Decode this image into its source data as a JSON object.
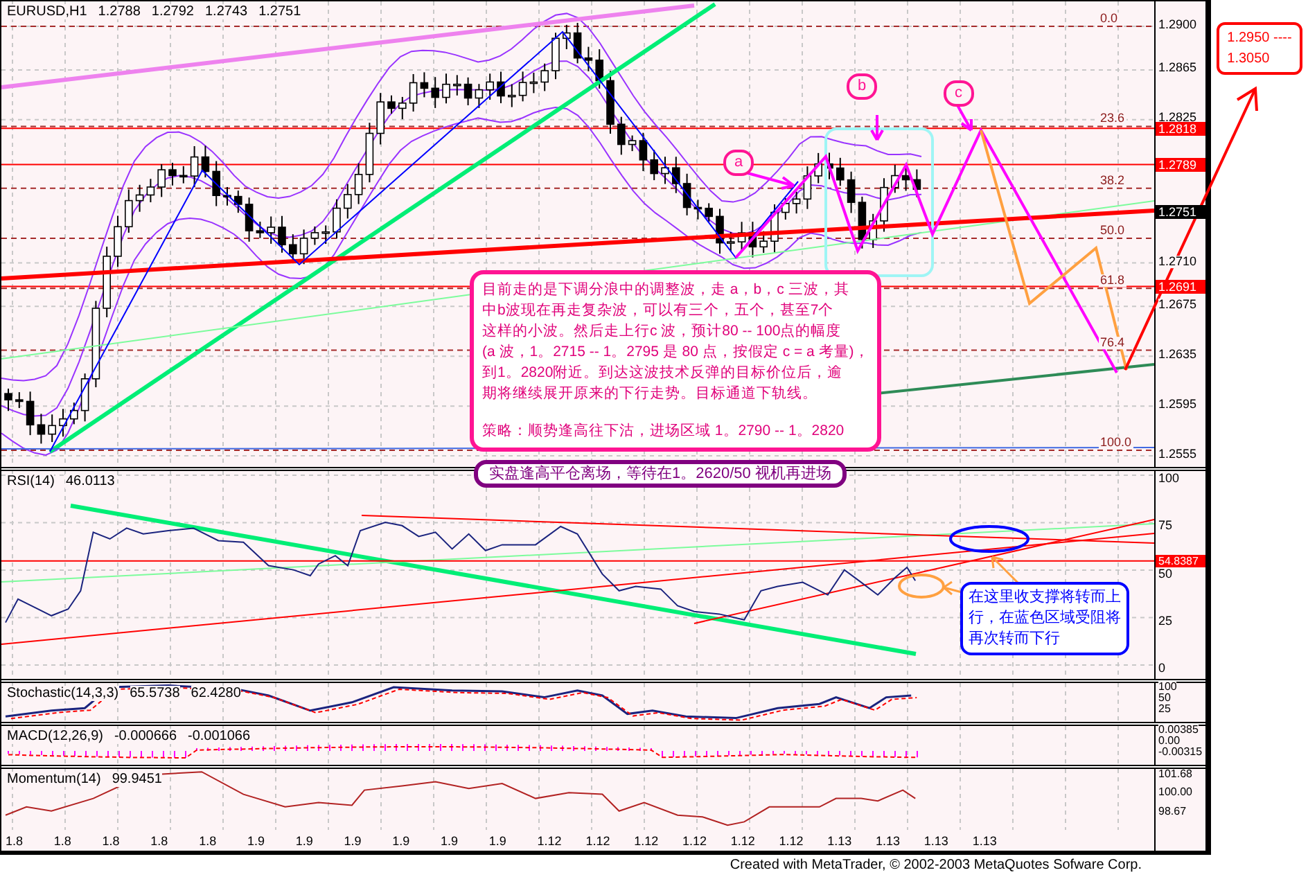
{
  "header": {
    "symbol": "EURUSD,H1",
    "quotes": [
      "1.2788",
      "1.2792",
      "1.2743",
      "1.2751"
    ]
  },
  "main_panel": {
    "price_axis": [
      "1.2900",
      "1.2865",
      "1.2825",
      "1.2710",
      "1.2675",
      "1.2635",
      "1.2595",
      "1.2555"
    ],
    "price_tags": [
      {
        "text": "1.2818",
        "color": "#ff0000"
      },
      {
        "text": "1.2789",
        "color": "#ff0000"
      },
      {
        "text": "1.2751",
        "color": "#000000"
      },
      {
        "text": "1.2691",
        "color": "#ff0000"
      }
    ],
    "fib_levels": [
      "0.0",
      "23.6",
      "38.2",
      "50.0",
      "61.8",
      "76.4",
      "100.0"
    ],
    "wave_labels": [
      "a",
      "b",
      "c"
    ],
    "note": {
      "lines": [
        "目前走的是下调分浪中的调整波，走 a，b，c 三波，其",
        "中b波现在再走复杂波，可以有三个，五个，甚至7个",
        "这样的小波。然后走上行c 波，预计80 -- 100点的幅度",
        "(a 波，1。2715 -- 1。2795 是 80 点，按假定 c = a 考量)，",
        "到1。2820附近。到达这波技术反弹的目标价位后，逾",
        "期将继续展开原来的下行走势。目标通道下轨线。"
      ],
      "strategy": "策略：顺势逢高往下沽，进场区域 1。2790 -- 1。2820"
    }
  },
  "exit_note": "实盘逢高平仓离场，等待在1。2620/50 视机再进场",
  "target_box": {
    "lines": [
      "1.2950 ----",
      "1.3050"
    ]
  },
  "rsi_panel": {
    "label": "RSI(14)",
    "value": "46.0113",
    "axis": [
      "100",
      "75",
      "50",
      "25",
      "0"
    ],
    "tag": "54.8387",
    "note": [
      "在这里收支撑将转而上",
      "行，在蓝色区域受阻将",
      "再次转而下行"
    ]
  },
  "stochastic_panel": {
    "label": "Stochastic(14,3,3)",
    "values": [
      "65.5738",
      "62.4280"
    ],
    "axis": [
      "100",
      "50",
      "25"
    ]
  },
  "macd_panel": {
    "label": "MACD(12,26,9)",
    "values": [
      "-0.000666",
      "-0.001066"
    ],
    "axis": [
      "0.00385",
      "0.00",
      "-0.00315"
    ]
  },
  "momentum_panel": {
    "label": "Momentum(14)",
    "value": "99.9451",
    "axis": [
      "101.68",
      "100.00",
      "98.67"
    ]
  },
  "x_axis": [
    "1.8",
    "1.8",
    "1.8",
    "1.8",
    "1.8",
    "1.9",
    "1.9",
    "1.9",
    "1.9",
    "1.9",
    "1.9",
    "1.12",
    "1.12",
    "1.12",
    "1.12",
    "1.12",
    "1.12",
    "1.13",
    "1.13",
    "1.13",
    "1.13"
  ],
  "footer": "Created with MetaTrader, © 2002-2003 MetaQuotes Sofware Corp."
}
